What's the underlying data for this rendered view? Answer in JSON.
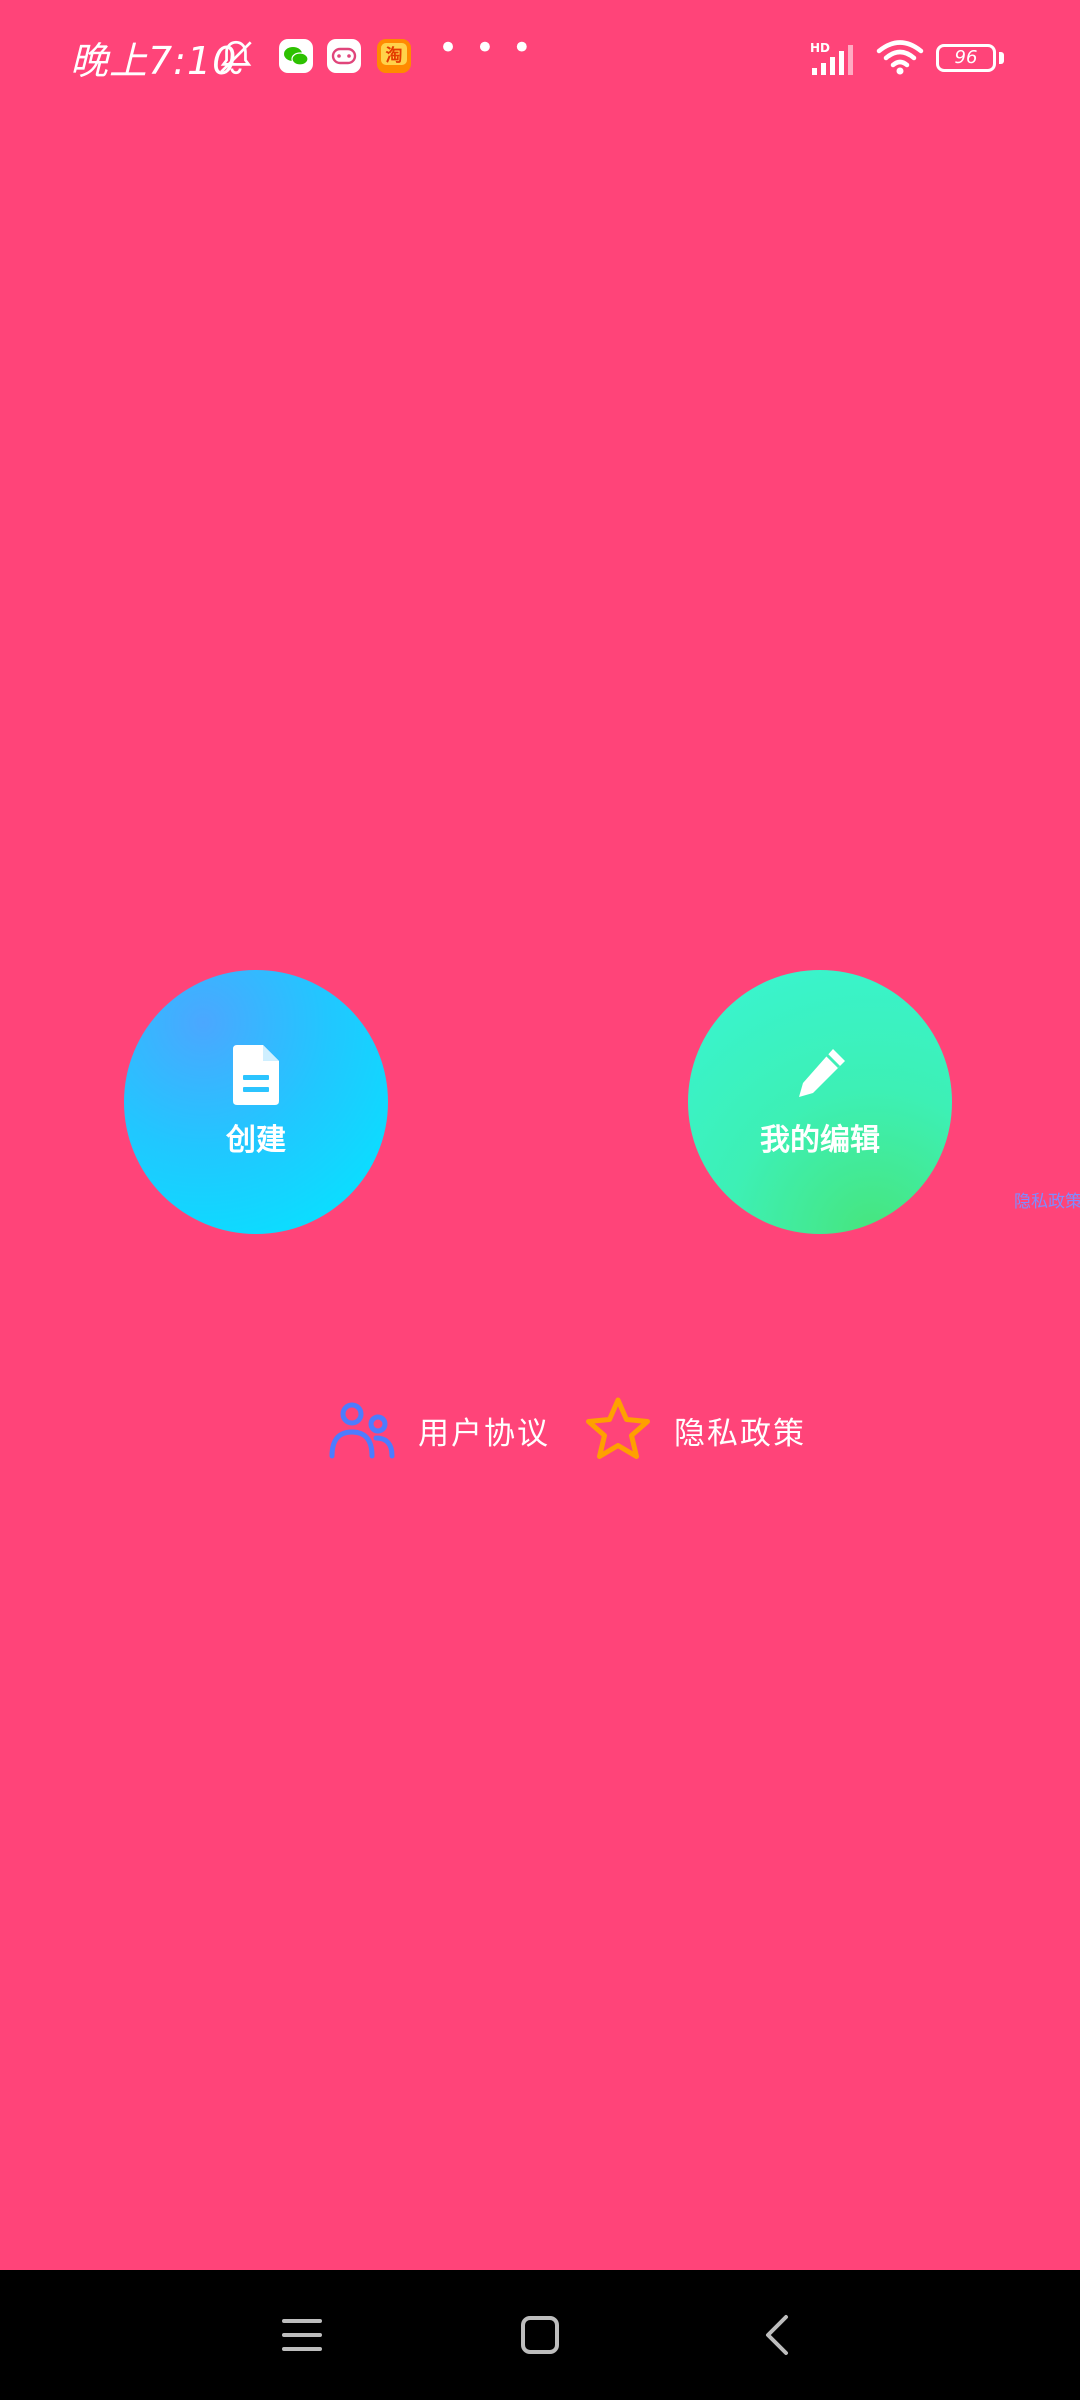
{
  "status_bar": {
    "time": "晚上7:10",
    "more": "• • •",
    "battery_level": "96",
    "icons": [
      "mute-bell-icon",
      "wechat-icon",
      "game-controller-icon",
      "taobao-icon",
      "more-dots-icon",
      "hd-signal-icon",
      "wifi-icon",
      "battery-icon"
    ]
  },
  "main": {
    "create_button": {
      "label": "创建",
      "icon": "document-icon",
      "gradient": [
        "#4BA7FF",
        "#00E9FF"
      ]
    },
    "edit_button": {
      "label": "我的编辑",
      "icon": "pencil-icon",
      "gradient": [
        "#38F5D4",
        "#47E57D"
      ]
    },
    "side_hint": "隐私政策"
  },
  "links": {
    "user_agreement": {
      "label": "用户协议",
      "icon": "users-icon",
      "icon_color": "#4D7CFE"
    },
    "privacy_policy": {
      "label": "隐私政策",
      "icon": "star-icon",
      "icon_color": "#FFA000"
    }
  },
  "nav_bar": {
    "buttons": [
      "menu-icon",
      "home-icon",
      "back-icon"
    ]
  },
  "colors": {
    "background": "#FF4479",
    "nav_background": "#000000"
  }
}
